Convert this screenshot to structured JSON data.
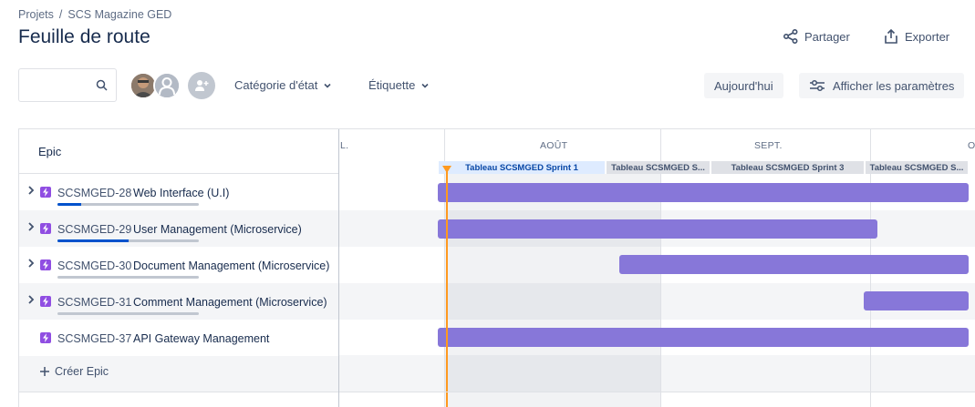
{
  "breadcrumb": {
    "items": [
      "Projets",
      "SCS Magazine GED"
    ],
    "separator": "/"
  },
  "page_title": "Feuille de route",
  "header_actions": {
    "share": "Partager",
    "export": "Exporter"
  },
  "search": {
    "placeholder": "",
    "value": ""
  },
  "filters": {
    "status_category": "Catégorie d'état",
    "label": "Étiquette"
  },
  "buttons": {
    "today": "Aujourd'hui",
    "view_settings": "Afficher les paramètres"
  },
  "roadmap": {
    "epic_column_header": "Epic",
    "months": [
      "L.",
      "AOÛT",
      "SEPT.",
      "O"
    ],
    "sprints": [
      {
        "label": "Tableau SCSMGED Sprint 1",
        "active": true
      },
      {
        "label": "Tableau SCSMGED S...",
        "active": false
      },
      {
        "label": "Tableau SCSMGED Sprint 3",
        "active": false
      },
      {
        "label": "Tableau SCSMGED S...",
        "active": false
      }
    ],
    "epics": [
      {
        "key": "SCSMGED-28",
        "name": "Web Interface (U.I)",
        "has_children": true,
        "progress": 0.17
      },
      {
        "key": "SCSMGED-29",
        "name": "User Management (Microservice)",
        "has_children": true,
        "progress": 0.5
      },
      {
        "key": "SCSMGED-30",
        "name": "Document Management (Microservice)",
        "has_children": true,
        "progress": 0
      },
      {
        "key": "SCSMGED-31",
        "name": "Comment Management (Microservice)",
        "has_children": true,
        "progress": 0
      },
      {
        "key": "SCSMGED-37",
        "name": "API Gateway Management",
        "has_children": false,
        "progress": null
      }
    ],
    "create_epic": "Créer Epic"
  },
  "colors": {
    "epic_bar": "#8777d9",
    "epic_icon": "#904ee2",
    "today_marker": "#ff991f",
    "progress_fill": "#0052cc",
    "active_sprint": "#deebff"
  }
}
